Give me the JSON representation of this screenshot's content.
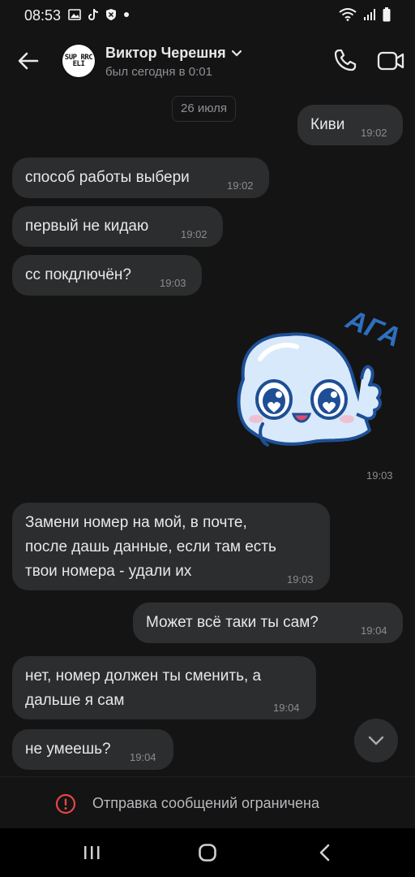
{
  "status_bar": {
    "time": "08:53",
    "left_icons": [
      "gallery-icon",
      "tiktok-icon",
      "shield-icon",
      "dot-icon"
    ],
    "right_icons": [
      "wifi-icon",
      "signal-icon",
      "battery-icon"
    ]
  },
  "header": {
    "contact_name": "Виктор Черешня",
    "last_seen": "был сегодня в 0:01",
    "avatar_text": "SUP RRC ELI",
    "icons": [
      "back-arrow-icon",
      "chevron-down-icon",
      "phone-icon",
      "video-camera-icon"
    ]
  },
  "chat": {
    "date_separator": "26 июля",
    "messages": [
      {
        "direction": "out",
        "text": "Киви",
        "time": "19:02"
      },
      {
        "direction": "in",
        "text": "способ работы выбери",
        "time": "19:02"
      },
      {
        "direction": "in",
        "text": "первый не кидаю",
        "time": "19:02"
      },
      {
        "direction": "in",
        "text": "сс покдлючён?",
        "time": "19:03"
      },
      {
        "direction": "out",
        "type": "sticker",
        "sticker_text": "АГА",
        "time": "19:03"
      },
      {
        "direction": "in",
        "lines": [
          "Замени номер на мой, в почте,",
          "после дашь данные, если там есть",
          "твои номера - удали их"
        ],
        "time": "19:03"
      },
      {
        "direction": "out",
        "text": "Может всё таки ты сам?",
        "time": "19:04"
      },
      {
        "direction": "in",
        "lines": [
          "нет, номер должен ты сменить, а",
          "дальше я сам"
        ],
        "time": "19:04"
      },
      {
        "direction": "in",
        "text": "не умеешь?",
        "time": "19:04"
      }
    ]
  },
  "footer": {
    "restricted_text": "Отправка сообщений ограничена"
  },
  "colors": {
    "background": "#141414",
    "bubble": "#2c2d2e",
    "alert_red": "#e64646",
    "sticker_blue": "#2f6fc0"
  }
}
